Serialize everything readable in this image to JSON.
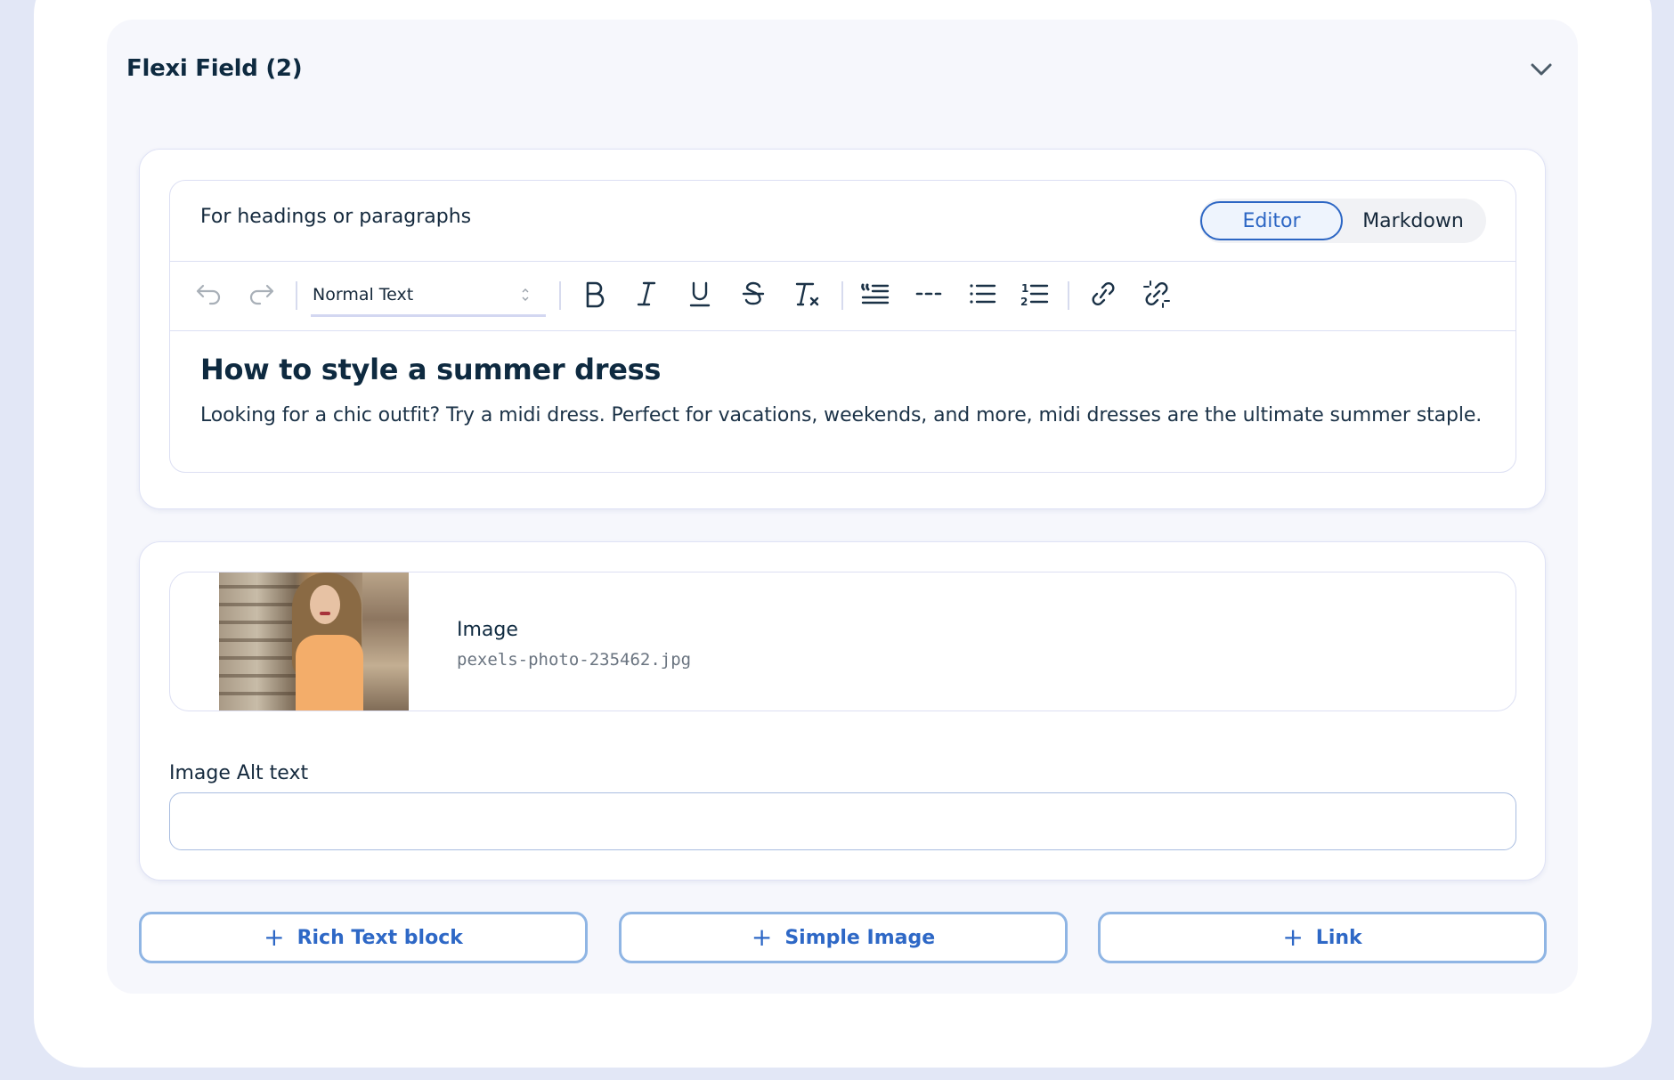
{
  "flexi_field": {
    "title": "Flexi Field (2)",
    "collapse_icon": "chevron-down-icon"
  },
  "rich_text_block": {
    "label": "For headings or paragraphs",
    "mode_toggle": {
      "options": [
        "Editor",
        "Markdown"
      ],
      "selected": "Editor"
    },
    "toolbar": {
      "undo_icon": "undo-icon",
      "redo_icon": "redo-icon",
      "text_style": "Normal Text",
      "buttons": [
        "bold",
        "italic",
        "underline",
        "strikethrough",
        "clear-formatting",
        "blockquote",
        "horizontal-rule",
        "bulleted-list",
        "numbered-list",
        "link",
        "unlink"
      ]
    },
    "content": {
      "heading": "How to style a summer dress",
      "paragraph": "Looking for a chic outfit? Try a midi dress. Perfect for vacations, weekends, and more, midi dresses are the ultimate summer staple."
    }
  },
  "simple_image_block": {
    "image_label": "Image",
    "file_name": "pexels-photo-235462.jpg",
    "alt_text_label": "Image Alt text",
    "alt_text_value": "",
    "alt_text_placeholder": ""
  },
  "add_buttons": [
    {
      "label": "Rich Text block",
      "icon": "plus-icon"
    },
    {
      "label": "Simple Image",
      "icon": "plus-icon"
    },
    {
      "label": "Link",
      "icon": "plus-icon"
    }
  ],
  "colors": {
    "accent": "#2c66c4",
    "button_border": "#8fb5e4",
    "text_primary": "#0e2a40",
    "card_background": "#f6f7fc",
    "page_background": "#e2e7f6"
  }
}
